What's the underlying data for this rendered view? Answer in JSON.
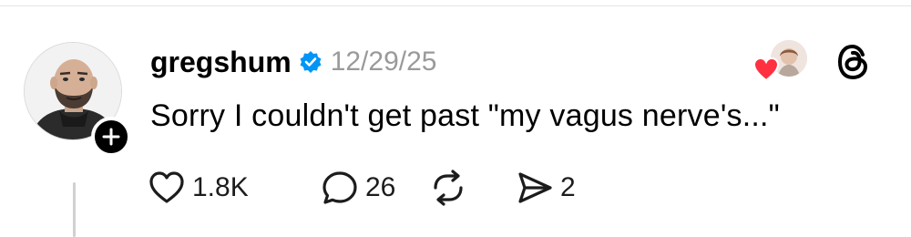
{
  "post": {
    "username": "gregshum",
    "verified": true,
    "timestamp": "12/29/25",
    "text": "Sorry I couldn't get past \"my vagus nerve's...\""
  },
  "actions": {
    "like_count": "1.8K",
    "comment_count": "26",
    "share_count": "2"
  },
  "icons": {
    "like": "heart-outline-icon",
    "comment": "speech-bubble-icon",
    "repost": "repost-arrows-icon",
    "share": "send-paper-plane-icon",
    "follow": "plus-icon",
    "verified": "verified-badge-icon",
    "brand": "threads-logo-icon",
    "reaction": "red-heart-icon"
  },
  "colors": {
    "text": "#000000",
    "muted": "#9a9a9a",
    "verified_blue": "#0095f6",
    "reaction_red": "#ff3040",
    "follow_button": "#000000"
  }
}
